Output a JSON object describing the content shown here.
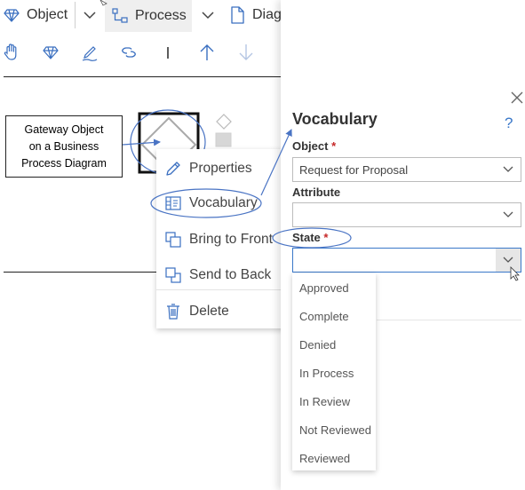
{
  "toolbar": {
    "tab_object": "Object",
    "tab_process": "Process",
    "tab_diagram": "Diag",
    "icons": [
      "hand-icon",
      "diamond-icon",
      "pen-icon",
      "link-icon",
      "bar-icon",
      "arrow-up-icon",
      "arrow-down-icon"
    ]
  },
  "callout": {
    "line1": "Gateway Object",
    "line2": "on a Business",
    "line3": "Process Diagram"
  },
  "context_menu": {
    "items": [
      {
        "label": "Properties",
        "icon": "pencil-icon"
      },
      {
        "label": "Vocabulary",
        "icon": "vocabulary-icon"
      },
      {
        "label": "Bring to Front",
        "icon": "bring-front-icon"
      },
      {
        "label": "Send to Back",
        "icon": "send-back-icon"
      },
      {
        "label": "Delete",
        "icon": "trash-icon"
      }
    ]
  },
  "panel": {
    "title": "Vocabulary",
    "help": "?",
    "object_label": "Object",
    "object_value": "Request for Proposal",
    "attribute_label": "Attribute",
    "attribute_value": "",
    "state_label": "State",
    "state_value": "",
    "required_mark": "*",
    "state_options": [
      "Approved",
      "Complete",
      "Denied",
      "In Process",
      "In Review",
      "Not Reviewed",
      "Reviewed"
    ]
  },
  "colors": {
    "accent": "#3a78c9",
    "annotation": "#4a74c4",
    "required": "#c62828",
    "tab_active_bg": "#efefef"
  }
}
